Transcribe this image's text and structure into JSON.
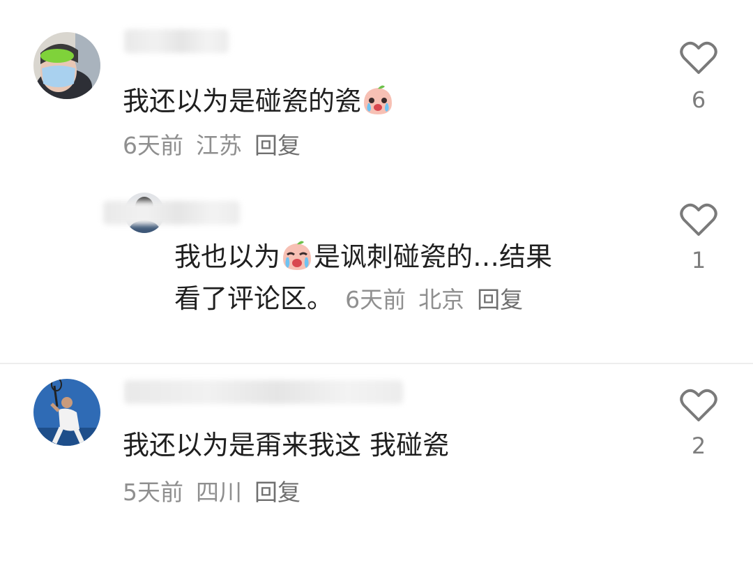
{
  "comments": [
    {
      "text_before_emoji": "我还以为是碰瓷的瓷",
      "emoji": "crying-peach-emoji",
      "time": "6天前",
      "location": "江苏",
      "reply_label": "回复",
      "likes": "6"
    },
    {
      "is_reply": true,
      "text_line1_before_emoji": "我也以为",
      "emoji": "crying-peach-emoji",
      "text_line1_after_emoji": "是讽刺碰瓷的…结果",
      "text_line2": "看了评论区。",
      "time": "6天前",
      "location": "北京",
      "reply_label": "回复",
      "likes": "1"
    },
    {
      "text": "我还以为是甭来我这 我碰瓷",
      "time": "5天前",
      "location": "四川",
      "reply_label": "回复",
      "likes": "2"
    }
  ],
  "icons": {
    "like": "heart-outline-icon"
  },
  "colors": {
    "text": "#1f1f1f",
    "meta": "#8f8f8f",
    "divider": "#ededed"
  }
}
